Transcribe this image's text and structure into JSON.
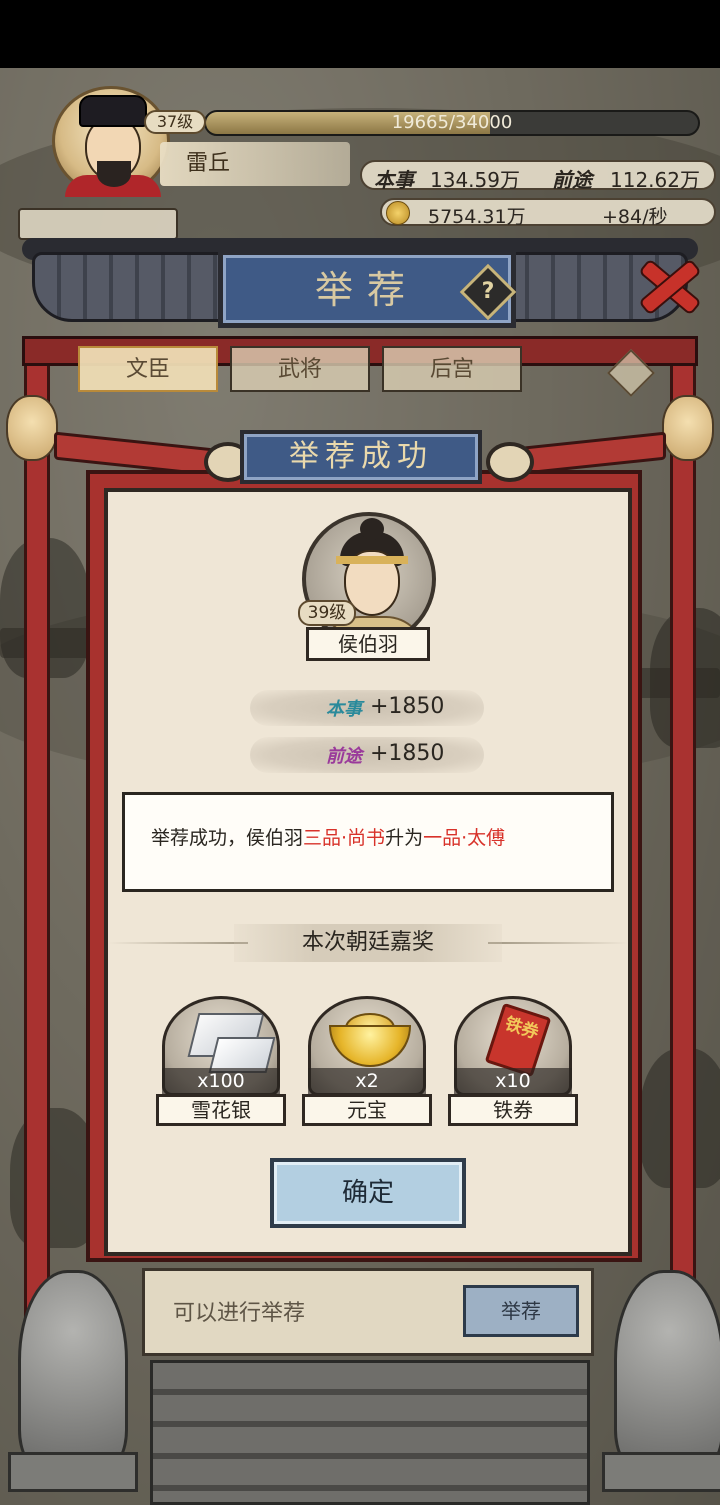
{
  "player": {
    "level": "37级",
    "exp_text": "19665/34000",
    "exp_progress": 0.578,
    "name": "雷丘",
    "benshi_label": "本事",
    "benshi_value": "134.59万",
    "qiantu_label": "前途",
    "qiantu_value": "112.62万",
    "coins_value": "5754.31万",
    "coins_rate": "+84/秒"
  },
  "page": {
    "title": "举荐",
    "help_symbol": "?",
    "tabs": [
      "文臣",
      "武将",
      "后宫"
    ]
  },
  "modal": {
    "title": "举荐成功",
    "hero": {
      "level": "39级",
      "name": "侯伯羽"
    },
    "stats": [
      {
        "label": "本事",
        "value": "+1850"
      },
      {
        "label": "前途",
        "value": "+1850"
      }
    ],
    "message": {
      "prefix": "举荐成功，侯伯羽",
      "old_rank": "三品·尚书",
      "middle": "升为",
      "new_rank": "一品·太傅"
    },
    "reward_header": "本次朝廷嘉奖",
    "rewards": [
      {
        "name": "雪花银",
        "count": "x100",
        "icon": "silver-icon"
      },
      {
        "name": "元宝",
        "count": "x2",
        "icon": "gold-ingot-icon"
      },
      {
        "name": "铁券",
        "count": "x10",
        "icon": "iron-ticket-icon",
        "icon_text": "铁券"
      }
    ],
    "confirm_label": "确定"
  },
  "bottom": {
    "hint": "可以进行举荐",
    "recommend_label": "举荐"
  },
  "colors": {
    "accent_red": "#d8322a",
    "sign_blue": "#3f5a86",
    "benshi": "#2a8a9b",
    "qiantu": "#9a3a9b"
  }
}
